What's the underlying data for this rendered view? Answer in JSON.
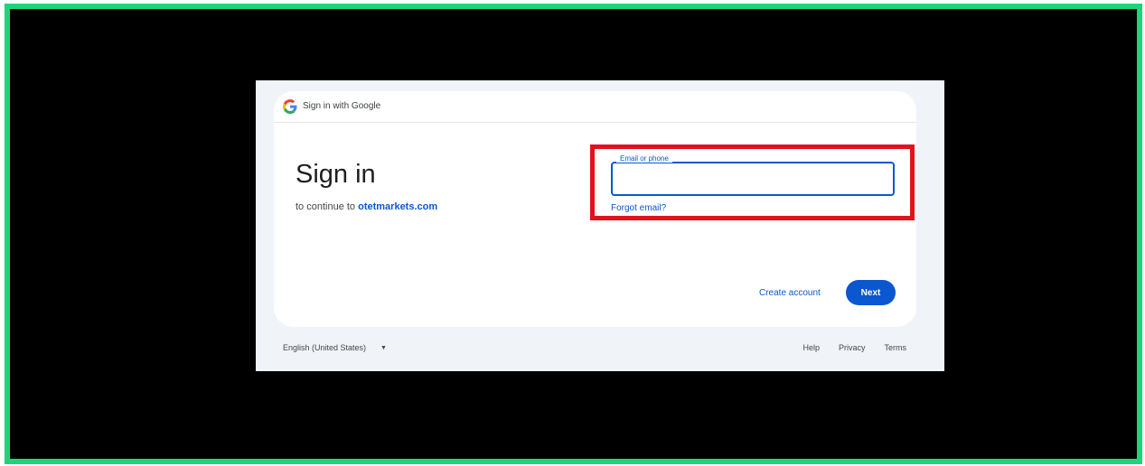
{
  "header": {
    "title": "Sign in with Google",
    "logo_icon": "google-g-icon"
  },
  "main": {
    "title": "Sign in",
    "subtitle_prefix": "to continue to ",
    "subtitle_domain": "otetmarkets.com"
  },
  "form": {
    "email_label": "Email or phone",
    "email_value": "",
    "forgot_email": "Forgot email?"
  },
  "actions": {
    "create_account": "Create account",
    "next": "Next"
  },
  "footer": {
    "language": "English (United States)",
    "links": [
      "Help",
      "Privacy",
      "Terms"
    ]
  },
  "colors": {
    "accent": "#0b57d0",
    "highlight_border": "#e2121b",
    "outer_frame": "#1ed47a"
  }
}
